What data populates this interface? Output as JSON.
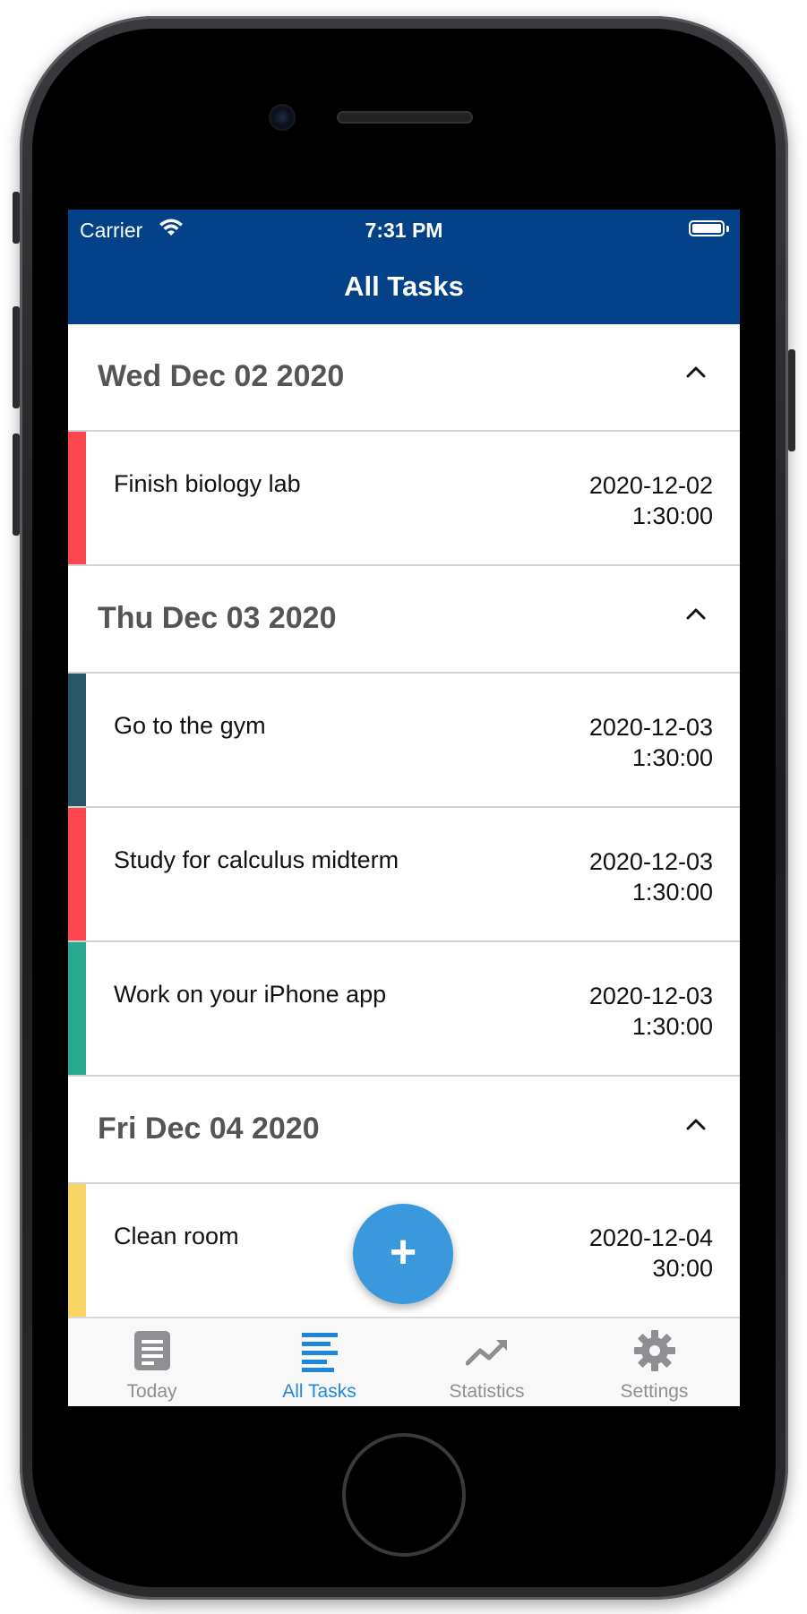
{
  "status_bar": {
    "carrier": "Carrier",
    "time": "7:31 PM"
  },
  "nav": {
    "title": "All Tasks"
  },
  "sections": [
    {
      "title": "Wed Dec 02 2020",
      "tasks": [
        {
          "title": "Finish biology lab",
          "date": "2020-12-02",
          "duration": "1:30:00",
          "color": "#fc474f"
        }
      ]
    },
    {
      "title": "Thu Dec 03 2020",
      "tasks": [
        {
          "title": "Go to the gym",
          "date": "2020-12-03",
          "duration": "1:30:00",
          "color": "#2a5767"
        },
        {
          "title": "Study for calculus midterm",
          "date": "2020-12-03",
          "duration": "1:30:00",
          "color": "#fc474f"
        },
        {
          "title": "Work on your iPhone app",
          "date": "2020-12-03",
          "duration": "1:30:00",
          "color": "#2ba891"
        }
      ]
    },
    {
      "title": "Fri Dec 04 2020",
      "tasks": [
        {
          "title": "Clean room",
          "date": "2020-12-04",
          "duration": "30:00",
          "color": "#f9d566"
        }
      ]
    }
  ],
  "fab": {
    "label": "+"
  },
  "tabs": [
    {
      "label": "Today",
      "icon": "document-icon"
    },
    {
      "label": "All Tasks",
      "icon": "list-icon",
      "active": true
    },
    {
      "label": "Statistics",
      "icon": "trend-icon"
    },
    {
      "label": "Settings",
      "icon": "gear-icon"
    }
  ],
  "colors": {
    "nav_background": "#034189",
    "tab_active": "#1f86dd",
    "tab_inactive": "#8e8e93",
    "fab": "#3a98dc"
  }
}
